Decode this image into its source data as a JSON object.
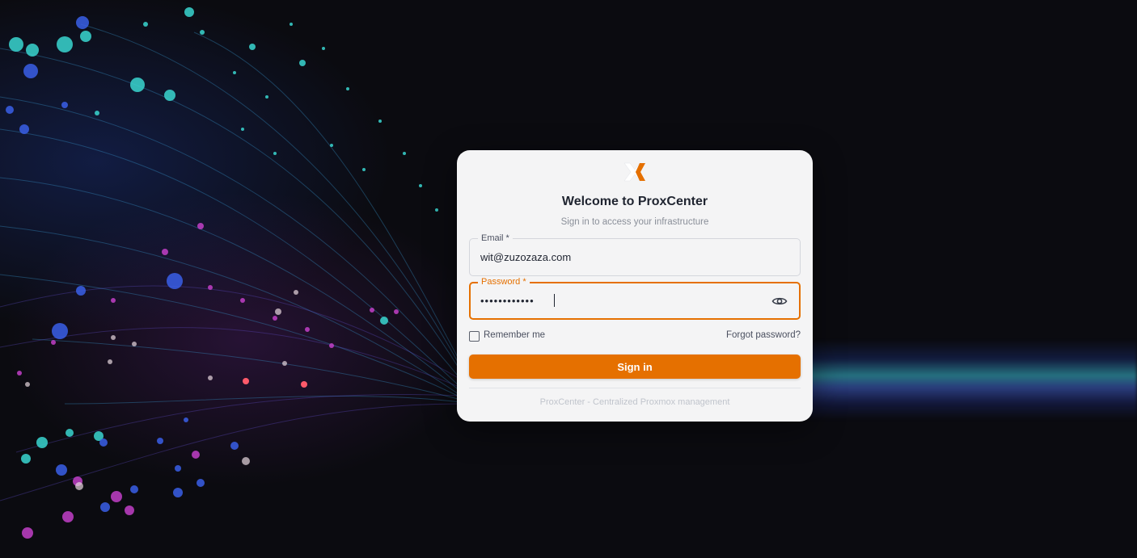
{
  "login": {
    "title": "Welcome to ProxCenter",
    "subtitle": "Sign in to access your infrastructure",
    "email_label": "Email *",
    "email_value": "wit@zuzozaza.com",
    "password_label": "Password *",
    "password_value": "••••••••••••",
    "remember_label": "Remember me",
    "forgot_label": "Forgot password?",
    "signin_label": "Sign in",
    "footer": "ProxCenter - Centralized Proxmox management"
  },
  "colors": {
    "accent": "#e57000",
    "card_bg": "#f4f4f5",
    "page_bg": "#0b0b10"
  },
  "icons": {
    "logo": "proxcenter-logo-icon",
    "toggle_password": "eye-icon"
  }
}
